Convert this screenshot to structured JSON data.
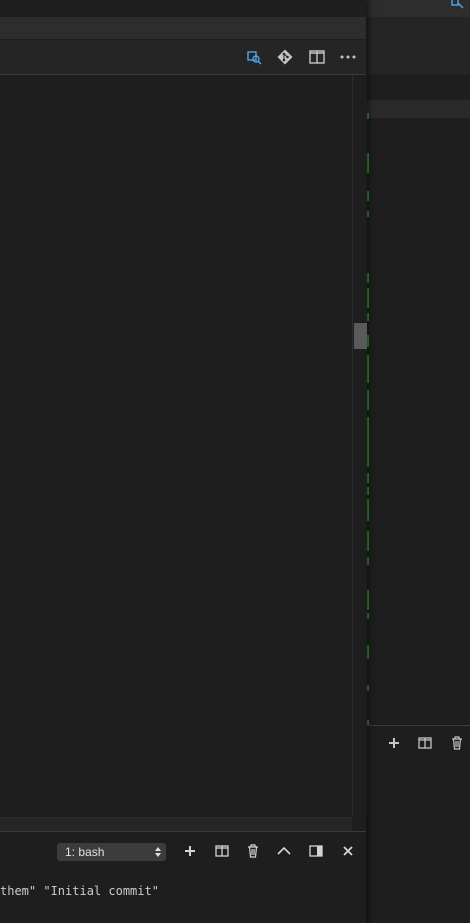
{
  "terminal": {
    "selected_shell": "1: bash",
    "output_line": "them\" \"Initial commit\""
  },
  "colors": {
    "git_added": "#2b8a2b",
    "link_icon": "#4fa3e8",
    "background": "#1e1e1e"
  },
  "icons": {
    "editor_toolbar": [
      "open-changes-icon",
      "git-icon",
      "split-editor-icon",
      "more-actions-icon"
    ],
    "terminal_panel": [
      "new-terminal-icon",
      "split-terminal-icon",
      "kill-terminal-icon",
      "maximize-panel-icon",
      "toggle-panel-position-icon",
      "close-panel-icon"
    ]
  }
}
